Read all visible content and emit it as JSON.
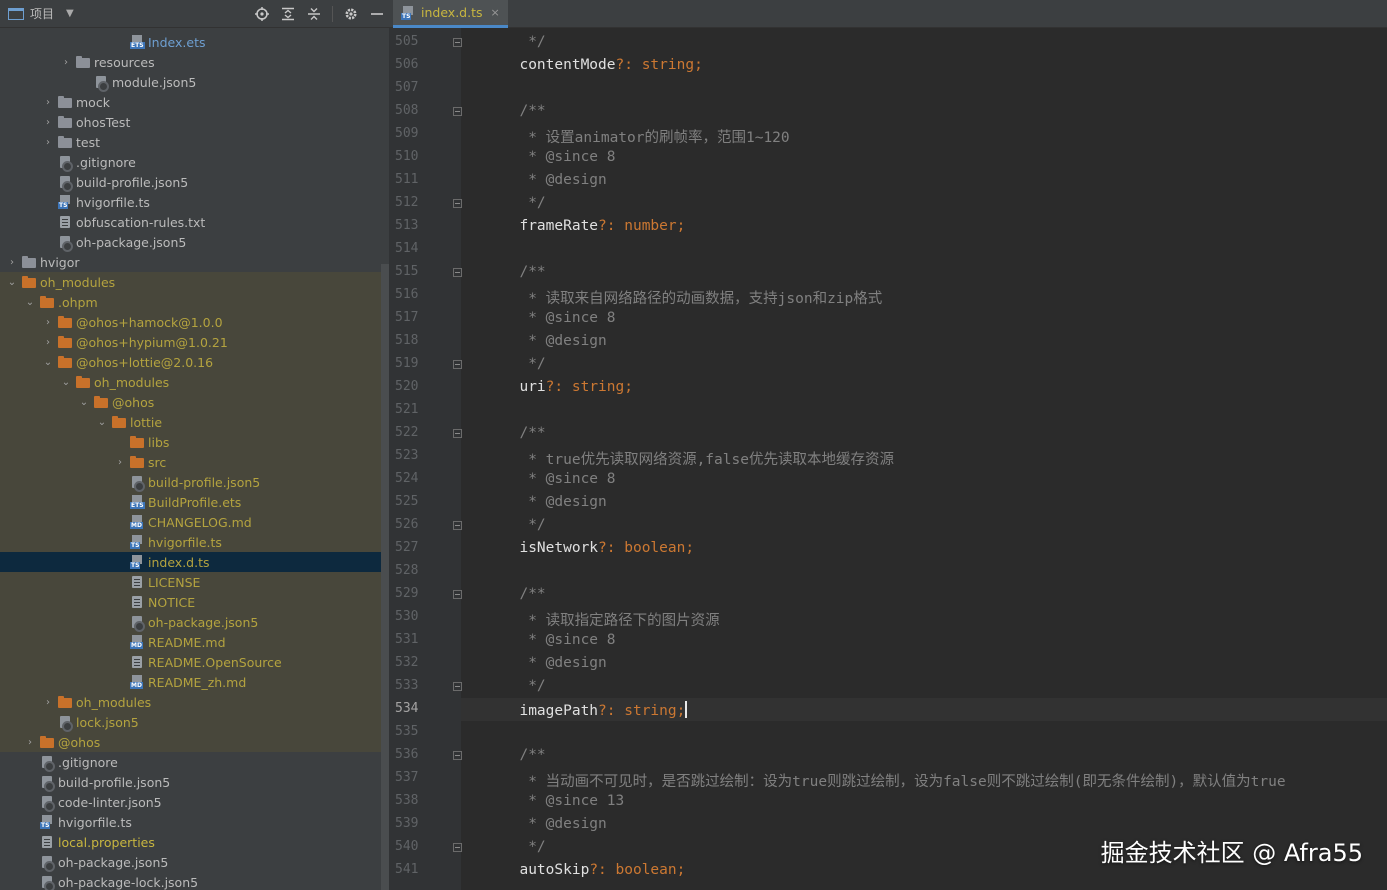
{
  "panel": {
    "title": "项目",
    "tools": [
      "locate-icon",
      "expand-all-icon",
      "collapse-all-icon",
      "settings-icon",
      "hide-icon"
    ]
  },
  "tree": [
    {
      "label": "Index.ets",
      "indent": 130,
      "chev": "",
      "icon": "badge",
      "badge": "ETS",
      "color": "blue",
      "excluded": false
    },
    {
      "label": "resources",
      "indent": 76,
      "chev": "›",
      "icon": "folder",
      "color": "",
      "excluded": false
    },
    {
      "label": "module.json5",
      "indent": 94,
      "chev": "",
      "icon": "gear",
      "color": "",
      "excluded": false
    },
    {
      "label": "mock",
      "indent": 58,
      "chev": "›",
      "icon": "folder",
      "color": "",
      "excluded": false
    },
    {
      "label": "ohosTest",
      "indent": 58,
      "chev": "›",
      "icon": "folder",
      "color": "",
      "excluded": false
    },
    {
      "label": "test",
      "indent": 58,
      "chev": "›",
      "icon": "folder",
      "color": "",
      "excluded": false
    },
    {
      "label": ".gitignore",
      "indent": 58,
      "chev": "",
      "icon": "gear",
      "color": "",
      "excluded": false
    },
    {
      "label": "build-profile.json5",
      "indent": 58,
      "chev": "",
      "icon": "gear",
      "color": "",
      "excluded": false
    },
    {
      "label": "hvigorfile.ts",
      "indent": 58,
      "chev": "",
      "icon": "badge",
      "badge": "TS",
      "color": "",
      "excluded": false
    },
    {
      "label": "obfuscation-rules.txt",
      "indent": 58,
      "chev": "",
      "icon": "file",
      "color": "",
      "excluded": false
    },
    {
      "label": "oh-package.json5",
      "indent": 58,
      "chev": "",
      "icon": "gear",
      "color": "",
      "excluded": false
    },
    {
      "label": "hvigor",
      "indent": 22,
      "chev": "›",
      "icon": "folder",
      "color": "",
      "excluded": false
    },
    {
      "label": "oh_modules",
      "indent": 22,
      "chev": "⌄",
      "icon": "folder-orange",
      "color": "excl",
      "excluded": true
    },
    {
      "label": ".ohpm",
      "indent": 40,
      "chev": "⌄",
      "icon": "folder-orange",
      "color": "excl",
      "excluded": true
    },
    {
      "label": "@ohos+hamock@1.0.0",
      "indent": 58,
      "chev": "›",
      "icon": "folder-orange",
      "color": "excl",
      "excluded": true
    },
    {
      "label": "@ohos+hypium@1.0.21",
      "indent": 58,
      "chev": "›",
      "icon": "folder-orange",
      "color": "excl",
      "excluded": true
    },
    {
      "label": "@ohos+lottie@2.0.16",
      "indent": 58,
      "chev": "⌄",
      "icon": "folder-orange",
      "color": "excl",
      "excluded": true
    },
    {
      "label": "oh_modules",
      "indent": 76,
      "chev": "⌄",
      "icon": "folder-orange",
      "color": "excl",
      "excluded": true
    },
    {
      "label": "@ohos",
      "indent": 94,
      "chev": "⌄",
      "icon": "folder-orange",
      "color": "excl",
      "excluded": true
    },
    {
      "label": "lottie",
      "indent": 112,
      "chev": "⌄",
      "icon": "folder-orange",
      "color": "excl",
      "excluded": true
    },
    {
      "label": "libs",
      "indent": 130,
      "chev": "",
      "icon": "folder-orange",
      "color": "excl",
      "excluded": true
    },
    {
      "label": "src",
      "indent": 130,
      "chev": "›",
      "icon": "folder-orange",
      "color": "excl",
      "excluded": true
    },
    {
      "label": "build-profile.json5",
      "indent": 130,
      "chev": "",
      "icon": "gear",
      "color": "excl",
      "excluded": true
    },
    {
      "label": "BuildProfile.ets",
      "indent": 130,
      "chev": "",
      "icon": "badge",
      "badge": "ETS",
      "color": "excl",
      "excluded": true
    },
    {
      "label": "CHANGELOG.md",
      "indent": 130,
      "chev": "",
      "icon": "badge",
      "badge": "MD",
      "color": "excl",
      "excluded": true
    },
    {
      "label": "hvigorfile.ts",
      "indent": 130,
      "chev": "",
      "icon": "badge",
      "badge": "TS",
      "color": "excl",
      "excluded": true
    },
    {
      "label": "index.d.ts",
      "indent": 130,
      "chev": "",
      "icon": "badge",
      "badge": "TS",
      "color": "excl",
      "excluded": false,
      "selected": true
    },
    {
      "label": "LICENSE",
      "indent": 130,
      "chev": "",
      "icon": "file",
      "color": "excl",
      "excluded": true
    },
    {
      "label": "NOTICE",
      "indent": 130,
      "chev": "",
      "icon": "file",
      "color": "excl",
      "excluded": true
    },
    {
      "label": "oh-package.json5",
      "indent": 130,
      "chev": "",
      "icon": "gear",
      "color": "excl",
      "excluded": true
    },
    {
      "label": "README.md",
      "indent": 130,
      "chev": "",
      "icon": "badge",
      "badge": "MD",
      "color": "excl",
      "excluded": true
    },
    {
      "label": "README.OpenSource",
      "indent": 130,
      "chev": "",
      "icon": "file",
      "color": "excl",
      "excluded": true
    },
    {
      "label": "README_zh.md",
      "indent": 130,
      "chev": "",
      "icon": "badge",
      "badge": "MD",
      "color": "excl",
      "excluded": true
    },
    {
      "label": "oh_modules",
      "indent": 58,
      "chev": "›",
      "icon": "folder-orange",
      "color": "excl",
      "excluded": true
    },
    {
      "label": "lock.json5",
      "indent": 58,
      "chev": "",
      "icon": "gear",
      "color": "excl",
      "excluded": true
    },
    {
      "label": "@ohos",
      "indent": 40,
      "chev": "›",
      "icon": "folder-orange",
      "color": "excl",
      "excluded": true
    },
    {
      "label": ".gitignore",
      "indent": 40,
      "chev": "",
      "icon": "gear",
      "color": "",
      "excluded": false
    },
    {
      "label": "build-profile.json5",
      "indent": 40,
      "chev": "",
      "icon": "gear",
      "color": "",
      "excluded": false
    },
    {
      "label": "code-linter.json5",
      "indent": 40,
      "chev": "",
      "icon": "gear",
      "color": "",
      "excluded": false
    },
    {
      "label": "hvigorfile.ts",
      "indent": 40,
      "chev": "",
      "icon": "badge",
      "badge": "TS",
      "color": "",
      "excluded": false
    },
    {
      "label": "local.properties",
      "indent": 40,
      "chev": "",
      "icon": "file",
      "color": "yellow",
      "excluded": false
    },
    {
      "label": "oh-package.json5",
      "indent": 40,
      "chev": "",
      "icon": "gear",
      "color": "",
      "excluded": false
    },
    {
      "label": "oh-package-lock.json5",
      "indent": 40,
      "chev": "",
      "icon": "gear",
      "color": "",
      "excluded": false
    }
  ],
  "editor": {
    "tab": {
      "label": "index.d.ts",
      "close": "×"
    },
    "current_line": 534,
    "lines": [
      {
        "n": "505",
        "fold": true,
        "tokens": [
          [
            "c",
            "   */"
          ]
        ]
      },
      {
        "n": "506",
        "fold": false,
        "tokens": [
          [
            "p",
            "  contentMode"
          ],
          [
            "k",
            "?: "
          ],
          [
            "t",
            "string"
          ],
          [
            "k",
            ";"
          ]
        ]
      },
      {
        "n": "507",
        "fold": false,
        "tokens": []
      },
      {
        "n": "508",
        "fold": true,
        "tokens": [
          [
            "c",
            "  /**"
          ]
        ]
      },
      {
        "n": "509",
        "fold": false,
        "tokens": [
          [
            "c",
            "   * 设置animator的刷帧率，范围1~120"
          ]
        ]
      },
      {
        "n": "510",
        "fold": false,
        "tokens": [
          [
            "c",
            "   * @since 8"
          ]
        ]
      },
      {
        "n": "511",
        "fold": false,
        "tokens": [
          [
            "c",
            "   * @design"
          ]
        ]
      },
      {
        "n": "512",
        "fold": true,
        "tokens": [
          [
            "c",
            "   */"
          ]
        ]
      },
      {
        "n": "513",
        "fold": false,
        "tokens": [
          [
            "p",
            "  frameRate"
          ],
          [
            "k",
            "?: "
          ],
          [
            "t",
            "number"
          ],
          [
            "k",
            ";"
          ]
        ]
      },
      {
        "n": "514",
        "fold": false,
        "tokens": []
      },
      {
        "n": "515",
        "fold": true,
        "tokens": [
          [
            "c",
            "  /**"
          ]
        ]
      },
      {
        "n": "516",
        "fold": false,
        "tokens": [
          [
            "c",
            "   * 读取来自网络路径的动画数据，支持json和zip格式"
          ]
        ]
      },
      {
        "n": "517",
        "fold": false,
        "tokens": [
          [
            "c",
            "   * @since 8"
          ]
        ]
      },
      {
        "n": "518",
        "fold": false,
        "tokens": [
          [
            "c",
            "   * @design"
          ]
        ]
      },
      {
        "n": "519",
        "fold": true,
        "tokens": [
          [
            "c",
            "   */"
          ]
        ]
      },
      {
        "n": "520",
        "fold": false,
        "tokens": [
          [
            "p",
            "  uri"
          ],
          [
            "k",
            "?: "
          ],
          [
            "t",
            "string"
          ],
          [
            "k",
            ";"
          ]
        ]
      },
      {
        "n": "521",
        "fold": false,
        "tokens": []
      },
      {
        "n": "522",
        "fold": true,
        "tokens": [
          [
            "c",
            "  /**"
          ]
        ]
      },
      {
        "n": "523",
        "fold": false,
        "tokens": [
          [
            "c",
            "   * true优先读取网络资源,false优先读取本地缓存资源"
          ]
        ]
      },
      {
        "n": "524",
        "fold": false,
        "tokens": [
          [
            "c",
            "   * @since 8"
          ]
        ]
      },
      {
        "n": "525",
        "fold": false,
        "tokens": [
          [
            "c",
            "   * @design"
          ]
        ]
      },
      {
        "n": "526",
        "fold": true,
        "tokens": [
          [
            "c",
            "   */"
          ]
        ]
      },
      {
        "n": "527",
        "fold": false,
        "tokens": [
          [
            "p",
            "  isNetwork"
          ],
          [
            "k",
            "?: "
          ],
          [
            "t",
            "boolean"
          ],
          [
            "k",
            ";"
          ]
        ]
      },
      {
        "n": "528",
        "fold": false,
        "tokens": []
      },
      {
        "n": "529",
        "fold": true,
        "tokens": [
          [
            "c",
            "  /**"
          ]
        ]
      },
      {
        "n": "530",
        "fold": false,
        "tokens": [
          [
            "c",
            "   * 读取指定路径下的图片资源"
          ]
        ]
      },
      {
        "n": "531",
        "fold": false,
        "tokens": [
          [
            "c",
            "   * @since 8"
          ]
        ]
      },
      {
        "n": "532",
        "fold": false,
        "tokens": [
          [
            "c",
            "   * @design"
          ]
        ]
      },
      {
        "n": "533",
        "fold": true,
        "tokens": [
          [
            "c",
            "   */"
          ]
        ]
      },
      {
        "n": "534",
        "fold": false,
        "tokens": [
          [
            "p",
            "  imagePath"
          ],
          [
            "k",
            "?: "
          ],
          [
            "t",
            "string"
          ],
          [
            "k",
            ";"
          ]
        ]
      },
      {
        "n": "535",
        "fold": false,
        "tokens": []
      },
      {
        "n": "536",
        "fold": true,
        "tokens": [
          [
            "c",
            "  /**"
          ]
        ]
      },
      {
        "n": "537",
        "fold": false,
        "tokens": [
          [
            "c",
            "   * 当动画不可见时，是否跳过绘制：设为true则跳过绘制，设为false则不跳过绘制(即无条件绘制)，默认值为true"
          ]
        ]
      },
      {
        "n": "538",
        "fold": false,
        "tokens": [
          [
            "c",
            "   * @since 13"
          ]
        ]
      },
      {
        "n": "539",
        "fold": false,
        "tokens": [
          [
            "c",
            "   * @design"
          ]
        ]
      },
      {
        "n": "540",
        "fold": true,
        "tokens": [
          [
            "c",
            "   */"
          ]
        ]
      },
      {
        "n": "541",
        "fold": false,
        "tokens": [
          [
            "p",
            "  autoSkip"
          ],
          [
            "k",
            "?: "
          ],
          [
            "t",
            "boolean"
          ],
          [
            "k",
            ";"
          ]
        ]
      }
    ]
  },
  "watermark": "掘金技术社区 @ Afra55"
}
